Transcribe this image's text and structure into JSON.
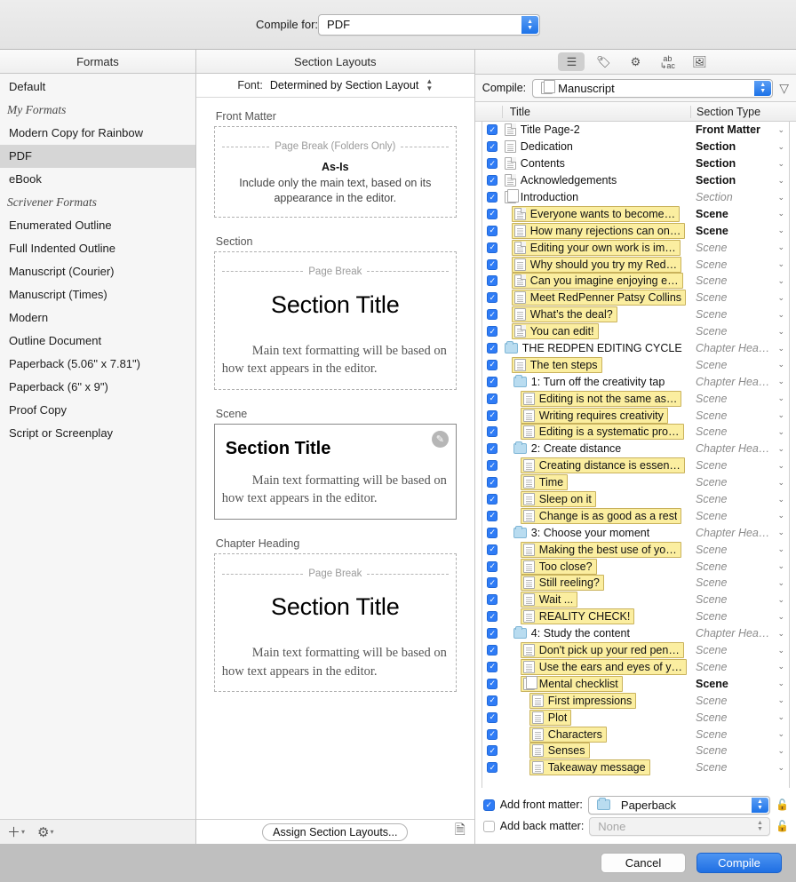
{
  "topbar": {
    "compile_for_label": "Compile for:",
    "compile_for_value": "PDF"
  },
  "columns": {
    "formats_header": "Formats",
    "layouts_header": "Section Layouts"
  },
  "formats": {
    "items": [
      {
        "label": "Default",
        "type": "item",
        "selected": false
      },
      {
        "label": "My Formats",
        "type": "group"
      },
      {
        "label": "Modern Copy for Rainbow",
        "type": "item",
        "selected": false
      },
      {
        "label": "PDF",
        "type": "item",
        "selected": true
      },
      {
        "label": "eBook",
        "type": "item",
        "selected": false
      },
      {
        "label": "Scrivener Formats",
        "type": "group"
      },
      {
        "label": "Enumerated Outline",
        "type": "item",
        "selected": false
      },
      {
        "label": "Full Indented Outline",
        "type": "item",
        "selected": false
      },
      {
        "label": "Manuscript (Courier)",
        "type": "item",
        "selected": false
      },
      {
        "label": "Manuscript (Times)",
        "type": "item",
        "selected": false
      },
      {
        "label": "Modern",
        "type": "item",
        "selected": false
      },
      {
        "label": "Outline Document",
        "type": "item",
        "selected": false
      },
      {
        "label": "Paperback (5.06\" x 7.81\")",
        "type": "item",
        "selected": false
      },
      {
        "label": "Paperback (6\" x 9\")",
        "type": "item",
        "selected": false
      },
      {
        "label": "Proof Copy",
        "type": "item",
        "selected": false
      },
      {
        "label": "Script or Screenplay",
        "type": "item",
        "selected": false
      }
    ],
    "footer": {
      "add_icon": "plus-icon",
      "settings_icon": "gear-icon"
    }
  },
  "layouts": {
    "font_label": "Font:",
    "font_value": "Determined by Section Layout",
    "cards": [
      {
        "label": "Front Matter",
        "page_break": "Page Break (Folders Only)",
        "title": "As-Is",
        "body": "Include only the main text, based on its appearance in the editor.",
        "style": "as-is"
      },
      {
        "label": "Section",
        "page_break": "Page Break",
        "title": "Section Title",
        "body": "Main text formatting will be based on how text appears in the editor.",
        "style": "centered"
      },
      {
        "label": "Scene",
        "page_break": "",
        "title": "Section Title",
        "body": "Main text formatting will be based on how text appears in the editor.",
        "style": "selected"
      },
      {
        "label": "Chapter Heading",
        "page_break": "Page Break",
        "title": "Section Title",
        "body": "Main text formatting will be based on how text appears in the editor.",
        "style": "centered"
      }
    ],
    "assign_button": "Assign Section Layouts...",
    "doc_icon": "document-icon"
  },
  "right": {
    "toolbar": [
      {
        "name": "contents-list-icon",
        "active": true
      },
      {
        "name": "tag-icon",
        "active": false
      },
      {
        "name": "gear-icon",
        "active": false
      },
      {
        "name": "replacements-icon",
        "active": false
      },
      {
        "name": "image-icon",
        "active": false
      }
    ],
    "compile_label": "Compile:",
    "compile_value": "Manuscript",
    "filter_icon": "funnel-icon",
    "headers": {
      "title": "Title",
      "section_type": "Section Type"
    },
    "rows": [
      {
        "checked": true,
        "indent": 0,
        "icon": "doc-corner",
        "title": "Title Page-2",
        "hl": false,
        "type": "Front Matter",
        "explicit": true
      },
      {
        "checked": true,
        "indent": 0,
        "icon": "doc",
        "title": "Dedication",
        "hl": false,
        "type": "Section",
        "explicit": true
      },
      {
        "checked": true,
        "indent": 0,
        "icon": "doc-corner",
        "title": "Contents",
        "hl": false,
        "type": "Section",
        "explicit": true
      },
      {
        "checked": true,
        "indent": 0,
        "icon": "doc-corner",
        "title": "Acknowledgements",
        "hl": false,
        "type": "Section",
        "explicit": true
      },
      {
        "checked": true,
        "indent": 0,
        "icon": "stack",
        "title": "Introduction",
        "hl": false,
        "type": "Section",
        "explicit": false
      },
      {
        "checked": true,
        "indent": 1,
        "icon": "doc-corner",
        "title": "Everyone wants to become…",
        "hl": true,
        "type": "Scene",
        "explicit": true
      },
      {
        "checked": true,
        "indent": 1,
        "icon": "doc",
        "title": "How many rejections can on…",
        "hl": true,
        "type": "Scene",
        "explicit": true
      },
      {
        "checked": true,
        "indent": 1,
        "icon": "doc-corner",
        "title": "Editing your own work is im…",
        "hl": true,
        "type": "Scene",
        "explicit": false
      },
      {
        "checked": true,
        "indent": 1,
        "icon": "doc",
        "title": "Why should you try my Red…",
        "hl": true,
        "type": "Scene",
        "explicit": false
      },
      {
        "checked": true,
        "indent": 1,
        "icon": "doc-corner",
        "title": "Can you imagine enjoying e…",
        "hl": true,
        "type": "Scene",
        "explicit": false
      },
      {
        "checked": true,
        "indent": 1,
        "icon": "doc",
        "title": "Meet RedPenner Patsy Collins",
        "hl": true,
        "type": "Scene",
        "explicit": false
      },
      {
        "checked": true,
        "indent": 1,
        "icon": "doc",
        "title": "What’s the deal?",
        "hl": true,
        "type": "Scene",
        "explicit": false
      },
      {
        "checked": true,
        "indent": 1,
        "icon": "doc-corner",
        "title": "You can edit!",
        "hl": true,
        "type": "Scene",
        "explicit": false
      },
      {
        "checked": true,
        "indent": 0,
        "icon": "folder",
        "title": "THE REDPEN EDITING CYCLE",
        "hl": false,
        "type": "Chapter Headi…",
        "explicit": false
      },
      {
        "checked": true,
        "indent": 1,
        "icon": "doc",
        "title": "The ten steps",
        "hl": true,
        "type": "Scene",
        "explicit": false
      },
      {
        "checked": true,
        "indent": 1,
        "icon": "folder",
        "title": "1: Turn off the creativity tap",
        "hl": false,
        "type": "Chapter Headi…",
        "explicit": false
      },
      {
        "checked": true,
        "indent": 2,
        "icon": "doc",
        "title": "Editing is not the same as…",
        "hl": true,
        "type": "Scene",
        "explicit": false
      },
      {
        "checked": true,
        "indent": 2,
        "icon": "doc",
        "title": "Writing requires creativity",
        "hl": true,
        "type": "Scene",
        "explicit": false
      },
      {
        "checked": true,
        "indent": 2,
        "icon": "doc",
        "title": "Editing is a systematic pro…",
        "hl": true,
        "type": "Scene",
        "explicit": false
      },
      {
        "checked": true,
        "indent": 1,
        "icon": "folder",
        "title": "2: Create distance",
        "hl": false,
        "type": "Chapter Headi…",
        "explicit": false
      },
      {
        "checked": true,
        "indent": 2,
        "icon": "doc",
        "title": "Creating distance is essen…",
        "hl": true,
        "type": "Scene",
        "explicit": false
      },
      {
        "checked": true,
        "indent": 2,
        "icon": "doc",
        "title": "Time",
        "hl": true,
        "type": "Scene",
        "explicit": false
      },
      {
        "checked": true,
        "indent": 2,
        "icon": "doc",
        "title": "Sleep on it",
        "hl": true,
        "type": "Scene",
        "explicit": false
      },
      {
        "checked": true,
        "indent": 2,
        "icon": "doc",
        "title": "Change is as good as a rest",
        "hl": true,
        "type": "Scene",
        "explicit": false
      },
      {
        "checked": true,
        "indent": 1,
        "icon": "folder",
        "title": "3: Choose your moment",
        "hl": false,
        "type": "Chapter Headi…",
        "explicit": false
      },
      {
        "checked": true,
        "indent": 2,
        "icon": "doc",
        "title": "Making the best use of yo…",
        "hl": true,
        "type": "Scene",
        "explicit": false
      },
      {
        "checked": true,
        "indent": 2,
        "icon": "doc",
        "title": "Too close?",
        "hl": true,
        "type": "Scene",
        "explicit": false
      },
      {
        "checked": true,
        "indent": 2,
        "icon": "doc",
        "title": "Still reeling?",
        "hl": true,
        "type": "Scene",
        "explicit": false
      },
      {
        "checked": true,
        "indent": 2,
        "icon": "doc",
        "title": "Wait ...",
        "hl": true,
        "type": "Scene",
        "explicit": false
      },
      {
        "checked": true,
        "indent": 2,
        "icon": "doc",
        "title": "REALITY CHECK!",
        "hl": true,
        "type": "Scene",
        "explicit": false
      },
      {
        "checked": true,
        "indent": 1,
        "icon": "folder",
        "title": "4: Study the content",
        "hl": false,
        "type": "Chapter Headi…",
        "explicit": false
      },
      {
        "checked": true,
        "indent": 2,
        "icon": "doc",
        "title": "Don't pick up your red pen…",
        "hl": true,
        "type": "Scene",
        "explicit": false
      },
      {
        "checked": true,
        "indent": 2,
        "icon": "doc",
        "title": "Use the ears and eyes of y…",
        "hl": true,
        "type": "Scene",
        "explicit": false
      },
      {
        "checked": true,
        "indent": 2,
        "icon": "stack",
        "title": "Mental checklist",
        "hl": true,
        "type": "Scene",
        "explicit": true
      },
      {
        "checked": true,
        "indent": 3,
        "icon": "doc",
        "title": "First impressions",
        "hl": true,
        "type": "Scene",
        "explicit": false
      },
      {
        "checked": true,
        "indent": 3,
        "icon": "doc",
        "title": "Plot",
        "hl": true,
        "type": "Scene",
        "explicit": false
      },
      {
        "checked": true,
        "indent": 3,
        "icon": "doc",
        "title": "Characters",
        "hl": true,
        "type": "Scene",
        "explicit": false
      },
      {
        "checked": true,
        "indent": 3,
        "icon": "doc",
        "title": "Senses",
        "hl": true,
        "type": "Scene",
        "explicit": false
      },
      {
        "checked": true,
        "indent": 3,
        "icon": "doc",
        "title": "Takeaway message",
        "hl": true,
        "type": "Scene",
        "explicit": false
      }
    ],
    "front_matter": {
      "checked": true,
      "label": "Add front matter:",
      "value": "Paperback",
      "lock_icon": "unlocked-icon"
    },
    "back_matter": {
      "checked": false,
      "label": "Add back matter:",
      "value": "None",
      "lock_icon": "unlocked-icon"
    }
  },
  "bottombar": {
    "cancel": "Cancel",
    "compile": "Compile"
  },
  "colors": {
    "accent": "#2f7cf6",
    "highlight": "#fbeea0",
    "highlight_border": "#c9b25c",
    "folder": "#b9dcf0"
  }
}
